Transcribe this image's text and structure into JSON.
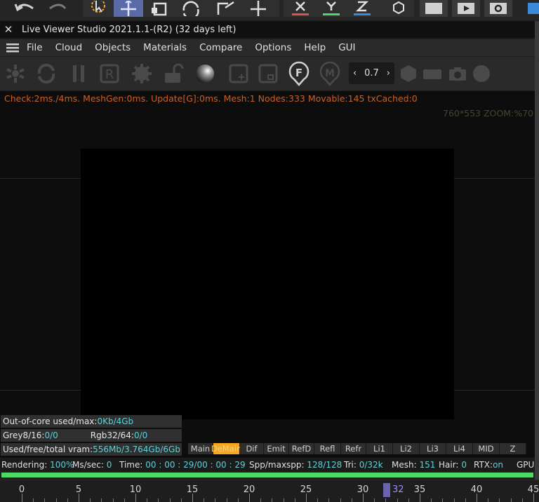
{
  "window": {
    "title": "Live Viewer Studio 2021.1.1-(R2) (32 days left)"
  },
  "menu": {
    "items": [
      "File",
      "Cloud",
      "Objects",
      "Materials",
      "Compare",
      "Options",
      "Help",
      "GUI"
    ]
  },
  "toolbar": {
    "spin_value": "0.7",
    "icons": [
      "snowflake-icon",
      "refresh-icon",
      "pause-icon",
      "region-icon",
      "gear-icon",
      "unlock-icon",
      "sphere-icon",
      "add-region-icon",
      "clear-region-icon",
      "focus-pick-icon",
      "material-pick-icon",
      "hexagon-icon",
      "rectangle-icon",
      "camera-icon",
      "circle-icon"
    ],
    "focus_letter": "F",
    "material_letter": "M",
    "region_letter": "R"
  },
  "viewport": {
    "stats": "Check:2ms./4ms. MeshGen:0ms. Update[G]:0ms. Mesh:1 Nodes:333 Movable:145 txCached:0",
    "zoom": "760*553 ZOOM:%70"
  },
  "info": {
    "out_of_core_label": "Out-of-core used/max:",
    "out_of_core_value": "0Kb/4Gb",
    "grey_label": "Grey8/16: ",
    "grey_value": "0/0",
    "rgb_label": "Rgb32/64: ",
    "rgb_value": "0/0",
    "vram_label": "Used/free/total vram: ",
    "vram_value": "556Mb/3.764Gb/6Gb"
  },
  "passes": {
    "items": [
      "Main",
      "DeMain",
      "Dif",
      "Emit",
      "RefD",
      "Refl",
      "Refr",
      "Li1",
      "Li2",
      "Li3",
      "Li4",
      "MID",
      "Z"
    ],
    "active": "DeMain"
  },
  "status": {
    "rendering_label": "Rendering:",
    "rendering_value": "100%",
    "mssec_label": "Ms/sec:",
    "mssec_value": "0",
    "time_label": "Time:",
    "time_value": "00 : 00 : 29/00 : 00 : 29",
    "spp_label": "Spp/maxspp:",
    "spp_value": "128/128",
    "tri_label": "Tri:",
    "tri_value": "0/32k",
    "mesh_label": "Mesh:",
    "mesh_value": "151",
    "hair_label": "Hair:",
    "hair_value": "0",
    "rtx_label": "RTX:",
    "rtx_value": "on",
    "gpu_label": "GPU",
    "progress": 1.0
  },
  "timeline": {
    "labels": [
      "0",
      "5",
      "10",
      "15",
      "20",
      "25",
      "30",
      "35",
      "40",
      "45"
    ],
    "current_frame": "32"
  },
  "colors": {
    "stats_text": "#c8612a",
    "value_text": "#5fd0d7",
    "active_pass": "#f5a623",
    "progress": "#4cd964",
    "playhead": "#6a64b0"
  }
}
